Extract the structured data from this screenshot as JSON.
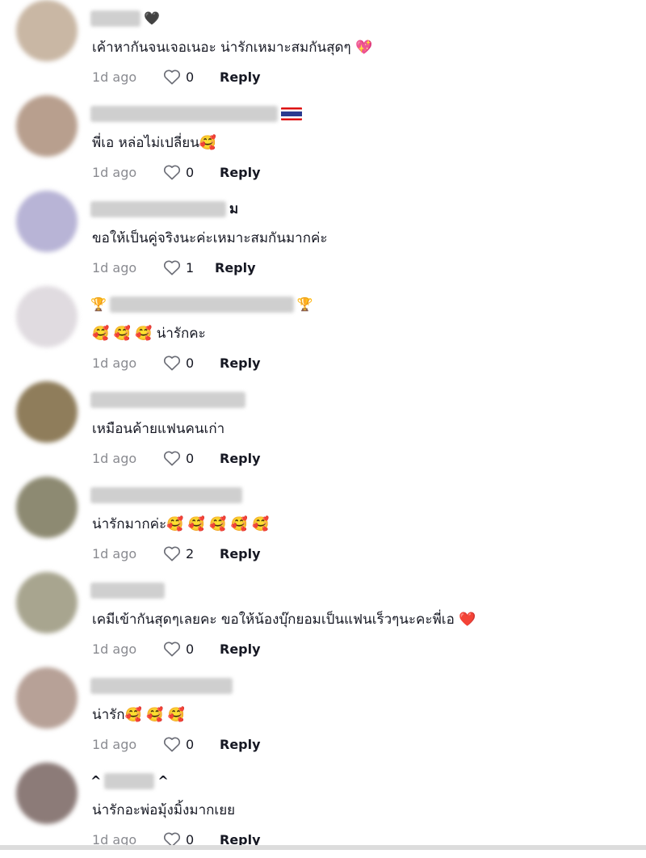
{
  "comments": [
    {
      "avatar_color": "#c9b7a4",
      "name_suffix": "🖤",
      "text": "เค้าหากันจนเจอเนอะ น่ารักเหมาะสมกันสุดๆ 💖",
      "time": "1d ago",
      "likes": "0",
      "reply": "Reply"
    },
    {
      "avatar_color": "#b89f8e",
      "name_suffix": "",
      "text": "พี่เอ หล่อไม่เปลี่ยน🥰",
      "time": "1d ago",
      "likes": "0",
      "reply": "Reply"
    },
    {
      "avatar_color": "#b8b4d6",
      "name_suffix": "ม",
      "text": "ขอให้เป็นคู่จริงนะค่ะเหมาะสมกันมากค่ะ",
      "time": "1d ago",
      "likes": "1",
      "reply": "Reply"
    },
    {
      "avatar_color": "#e0dbe0",
      "name_prefix": "🏆",
      "name_suffix": "🏆",
      "text": "🥰 🥰 🥰 น่ารักคะ",
      "time": "1d ago",
      "likes": "0",
      "reply": "Reply"
    },
    {
      "avatar_color": "#8f7d5b",
      "name_suffix": "",
      "text": "เหมือนค้ายแฟนคนเก่า",
      "time": "1d ago",
      "likes": "0",
      "reply": "Reply"
    },
    {
      "avatar_color": "#8d8a72",
      "name_suffix": "",
      "text": "น่ารักมากค่ะ🥰 🥰 🥰 🥰 🥰",
      "time": "1d ago",
      "likes": "2",
      "reply": "Reply"
    },
    {
      "avatar_color": "#a8a58f",
      "name_suffix": "",
      "text": "เคมีเข้ากันสุดๆเลยคะ ขอให้น้องบุ๊กยอมเป็นแฟนเร็วๆนะคะพี่เอ ❤️",
      "time": "1d ago",
      "likes": "0",
      "reply": "Reply"
    },
    {
      "avatar_color": "#b7a197",
      "name_suffix": "",
      "text": "น่ารัก🥰 🥰 🥰",
      "time": "1d ago",
      "likes": "0",
      "reply": "Reply"
    },
    {
      "avatar_color": "#8c7b78",
      "name_prefix": "^",
      "name_suffix": "^",
      "text": "น่ารักอะพ่อมุ้งมิ้งมากเยย",
      "time": "1d ago",
      "likes": "0",
      "reply": "Reply"
    }
  ]
}
